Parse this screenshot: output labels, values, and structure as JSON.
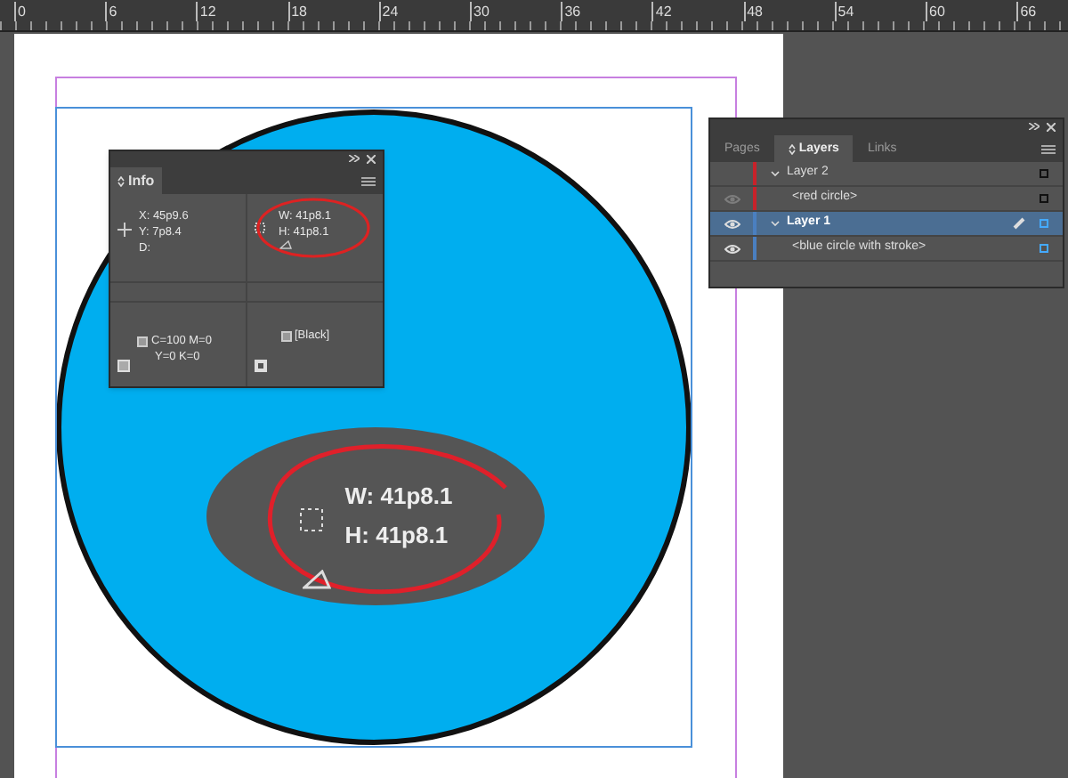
{
  "ruler": {
    "labels": [
      "0",
      "6",
      "12",
      "18",
      "24",
      "30",
      "36",
      "42",
      "48",
      "54",
      "60",
      "66"
    ]
  },
  "info_panel": {
    "title": "Info",
    "x": "X: 45p9.6",
    "y": "Y: 7p8.4",
    "d": "D:",
    "w": "W: 41p8.1",
    "h": "H: 41p8.1",
    "fill_lines": [
      "C=100 M=0",
      "Y=0 K=0"
    ],
    "stroke_label": "[Black]"
  },
  "callout": {
    "w": "W: 41p8.1",
    "h": "H: 41p8.1"
  },
  "layers_panel": {
    "tabs": [
      {
        "label": "Pages",
        "selected": false
      },
      {
        "label": "Layers",
        "selected": true
      },
      {
        "label": "Links",
        "selected": false
      }
    ],
    "layers": [
      {
        "name": "Layer 2",
        "color": "#c8222a",
        "visible": false,
        "selected": false,
        "children": [
          {
            "name": "<red circle>",
            "visible": true
          }
        ]
      },
      {
        "name": "Layer 1",
        "color": "#4a7fc0",
        "visible": true,
        "selected": true,
        "children": [
          {
            "name": "<blue circle with stroke>",
            "visible": true
          }
        ]
      }
    ]
  }
}
